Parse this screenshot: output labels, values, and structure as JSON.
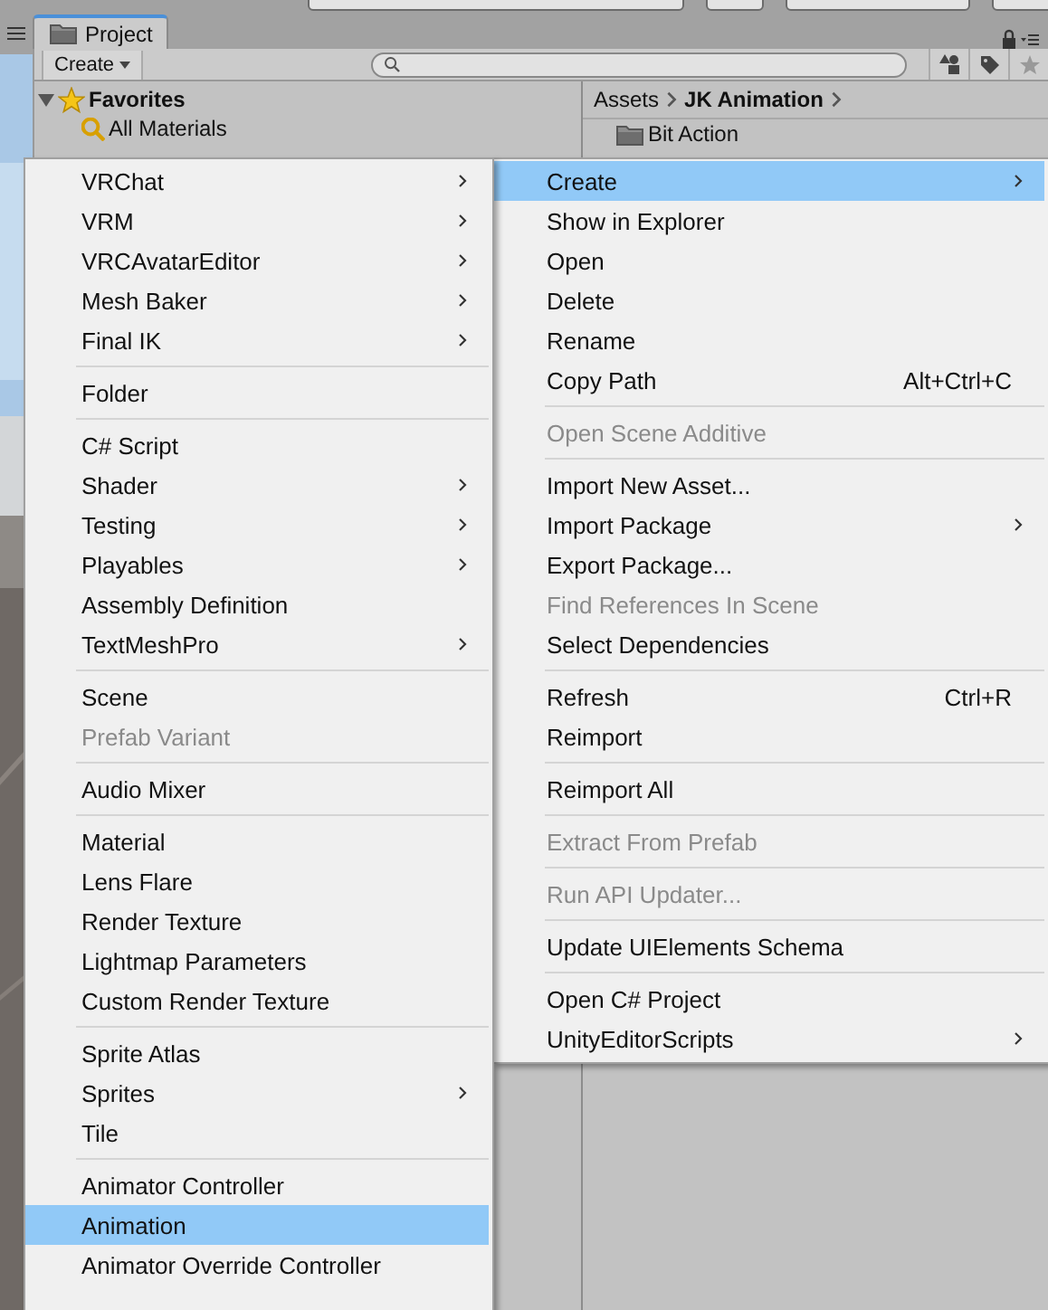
{
  "project_tab": {
    "title": "Project"
  },
  "toolbar": {
    "create_button": "Create"
  },
  "favorites": {
    "title": "Favorites",
    "expanded": true,
    "items": [
      "All Materials"
    ]
  },
  "breadcrumb": [
    "Assets",
    "JK Animation"
  ],
  "assets": [
    "Bit Action"
  ],
  "context_menu": {
    "items": [
      {
        "kind": "item",
        "label": "Create",
        "submenu": true,
        "selected": true,
        "disabled": false
      },
      {
        "kind": "item",
        "label": "Show in Explorer",
        "submenu": false,
        "selected": false,
        "disabled": false
      },
      {
        "kind": "item",
        "label": "Open",
        "submenu": false,
        "selected": false,
        "disabled": false
      },
      {
        "kind": "item",
        "label": "Delete",
        "submenu": false,
        "selected": false,
        "disabled": false
      },
      {
        "kind": "item",
        "label": "Rename",
        "submenu": false,
        "selected": false,
        "disabled": false
      },
      {
        "kind": "item",
        "label": "Copy Path",
        "shortcut": "Alt+Ctrl+C",
        "submenu": false,
        "selected": false,
        "disabled": false
      },
      {
        "kind": "separator"
      },
      {
        "kind": "item",
        "label": "Open Scene Additive",
        "submenu": false,
        "selected": false,
        "disabled": true
      },
      {
        "kind": "separator"
      },
      {
        "kind": "item",
        "label": "Import New Asset...",
        "submenu": false,
        "selected": false,
        "disabled": false
      },
      {
        "kind": "item",
        "label": "Import Package",
        "submenu": true,
        "selected": false,
        "disabled": false
      },
      {
        "kind": "item",
        "label": "Export Package...",
        "submenu": false,
        "selected": false,
        "disabled": false
      },
      {
        "kind": "item",
        "label": "Find References In Scene",
        "submenu": false,
        "selected": false,
        "disabled": true
      },
      {
        "kind": "item",
        "label": "Select Dependencies",
        "submenu": false,
        "selected": false,
        "disabled": false
      },
      {
        "kind": "separator"
      },
      {
        "kind": "item",
        "label": "Refresh",
        "shortcut": "Ctrl+R",
        "submenu": false,
        "selected": false,
        "disabled": false
      },
      {
        "kind": "item",
        "label": "Reimport",
        "submenu": false,
        "selected": false,
        "disabled": false
      },
      {
        "kind": "separator"
      },
      {
        "kind": "item",
        "label": "Reimport All",
        "submenu": false,
        "selected": false,
        "disabled": false
      },
      {
        "kind": "separator"
      },
      {
        "kind": "item",
        "label": "Extract From Prefab",
        "submenu": false,
        "selected": false,
        "disabled": true
      },
      {
        "kind": "separator"
      },
      {
        "kind": "item",
        "label": "Run API Updater...",
        "submenu": false,
        "selected": false,
        "disabled": true
      },
      {
        "kind": "separator"
      },
      {
        "kind": "item",
        "label": "Update UIElements Schema",
        "submenu": false,
        "selected": false,
        "disabled": false
      },
      {
        "kind": "separator"
      },
      {
        "kind": "item",
        "label": "Open C# Project",
        "submenu": false,
        "selected": false,
        "disabled": false
      },
      {
        "kind": "item",
        "label": "UnityEditorScripts",
        "submenu": true,
        "selected": false,
        "disabled": false
      }
    ]
  },
  "create_submenu": {
    "items": [
      {
        "kind": "item",
        "label": "VRChat",
        "submenu": true,
        "selected": false,
        "disabled": false
      },
      {
        "kind": "item",
        "label": "VRM",
        "submenu": true,
        "selected": false,
        "disabled": false
      },
      {
        "kind": "item",
        "label": "VRCAvatarEditor",
        "submenu": true,
        "selected": false,
        "disabled": false
      },
      {
        "kind": "item",
        "label": "Mesh Baker",
        "submenu": true,
        "selected": false,
        "disabled": false
      },
      {
        "kind": "item",
        "label": "Final IK",
        "submenu": true,
        "selected": false,
        "disabled": false
      },
      {
        "kind": "separator"
      },
      {
        "kind": "item",
        "label": "Folder",
        "submenu": false,
        "selected": false,
        "disabled": false
      },
      {
        "kind": "separator"
      },
      {
        "kind": "item",
        "label": "C# Script",
        "submenu": false,
        "selected": false,
        "disabled": false
      },
      {
        "kind": "item",
        "label": "Shader",
        "submenu": true,
        "selected": false,
        "disabled": false
      },
      {
        "kind": "item",
        "label": "Testing",
        "submenu": true,
        "selected": false,
        "disabled": false
      },
      {
        "kind": "item",
        "label": "Playables",
        "submenu": true,
        "selected": false,
        "disabled": false
      },
      {
        "kind": "item",
        "label": "Assembly Definition",
        "submenu": false,
        "selected": false,
        "disabled": false
      },
      {
        "kind": "item",
        "label": "TextMeshPro",
        "submenu": true,
        "selected": false,
        "disabled": false
      },
      {
        "kind": "separator"
      },
      {
        "kind": "item",
        "label": "Scene",
        "submenu": false,
        "selected": false,
        "disabled": false
      },
      {
        "kind": "item",
        "label": "Prefab Variant",
        "submenu": false,
        "selected": false,
        "disabled": true
      },
      {
        "kind": "separator"
      },
      {
        "kind": "item",
        "label": "Audio Mixer",
        "submenu": false,
        "selected": false,
        "disabled": false
      },
      {
        "kind": "separator"
      },
      {
        "kind": "item",
        "label": "Material",
        "submenu": false,
        "selected": false,
        "disabled": false
      },
      {
        "kind": "item",
        "label": "Lens Flare",
        "submenu": false,
        "selected": false,
        "disabled": false
      },
      {
        "kind": "item",
        "label": "Render Texture",
        "submenu": false,
        "selected": false,
        "disabled": false
      },
      {
        "kind": "item",
        "label": "Lightmap Parameters",
        "submenu": false,
        "selected": false,
        "disabled": false
      },
      {
        "kind": "item",
        "label": "Custom Render Texture",
        "submenu": false,
        "selected": false,
        "disabled": false
      },
      {
        "kind": "separator"
      },
      {
        "kind": "item",
        "label": "Sprite Atlas",
        "submenu": false,
        "selected": false,
        "disabled": false
      },
      {
        "kind": "item",
        "label": "Sprites",
        "submenu": true,
        "selected": false,
        "disabled": false
      },
      {
        "kind": "item",
        "label": "Tile",
        "submenu": false,
        "selected": false,
        "disabled": false
      },
      {
        "kind": "separator"
      },
      {
        "kind": "item",
        "label": "Animator Controller",
        "submenu": false,
        "selected": false,
        "disabled": false
      },
      {
        "kind": "item",
        "label": "Animation",
        "submenu": false,
        "selected": true,
        "disabled": false
      },
      {
        "kind": "item",
        "label": "Animator Override Controller",
        "submenu": false,
        "selected": false,
        "disabled": false
      }
    ]
  }
}
